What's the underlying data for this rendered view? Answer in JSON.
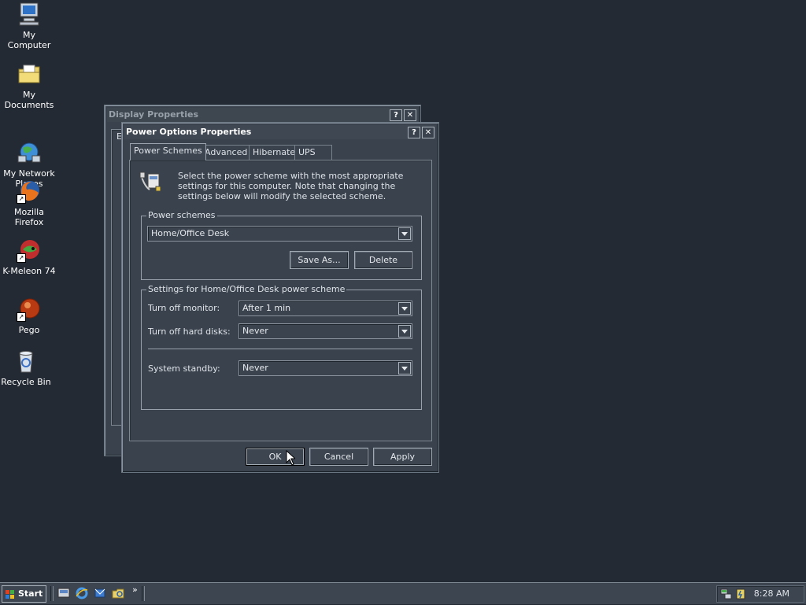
{
  "desktop": {
    "icons": [
      {
        "label": "My Computer",
        "icon": "computer-icon"
      },
      {
        "label": "My Documents",
        "icon": "folder-icon"
      },
      {
        "label": "My Network\nPlaces",
        "icon": "network-icon"
      },
      {
        "label": "Mozilla Firefox",
        "icon": "firefox-icon"
      },
      {
        "label": "K-Meleon 74",
        "icon": "kmeleon-icon"
      },
      {
        "label": "Pego",
        "icon": "pego-icon"
      },
      {
        "label": "Recycle Bin",
        "icon": "recycle-bin-icon"
      }
    ]
  },
  "display_window": {
    "title": "Display Properties",
    "help": "?",
    "close": "✕",
    "tab_fragment": "E"
  },
  "power_window": {
    "title": "Power Options Properties",
    "help": "?",
    "close": "✕",
    "tabs": [
      "Power Schemes",
      "Advanced",
      "Hibernate",
      "UPS"
    ],
    "selected_tab": "Power Schemes",
    "description": "Select the power scheme with the most appropriate settings for this computer. Note that changing the settings below will modify the selected scheme.",
    "schemes_group_label": "Power schemes",
    "selected_scheme": "Home/Office Desk",
    "save_as_label": "Save As...",
    "delete_label": "Delete",
    "settings_group_label": "Settings for Home/Office Desk power scheme",
    "monitor_label": "Turn off monitor:",
    "monitor_value": "After 1 min",
    "hard_disks_label": "Turn off hard disks:",
    "hard_disks_value": "Never",
    "standby_label": "System standby:",
    "standby_value": "Never",
    "ok_label": "OK",
    "cancel_label": "Cancel",
    "apply_label": "Apply"
  },
  "taskbar": {
    "start_label": "Start",
    "quick_launch": [
      "show-desktop-icon",
      "ie-icon",
      "outlook-icon",
      "explorer-icon"
    ],
    "overflow": "»",
    "clock": "8:28 AM"
  }
}
